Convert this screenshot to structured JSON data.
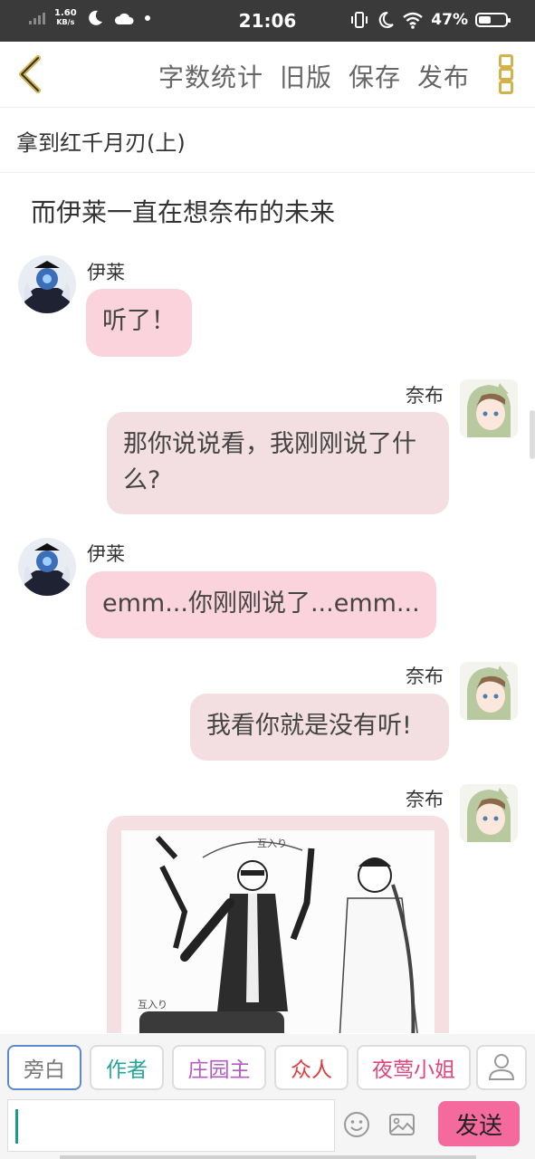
{
  "status_bar": {
    "speed_value": "1.60",
    "speed_unit": "KB/s",
    "time": "21:06",
    "battery": "47%",
    "battery_level": 0.47
  },
  "toolbar": {
    "actions": [
      "字数统计",
      "旧版",
      "保存",
      "发布"
    ]
  },
  "chapter_title": "拿到红千月刃(上)",
  "narration": "而伊莱一直在想奈布的未来",
  "messages": [
    {
      "speaker": "伊莱",
      "text": "听了！"
    },
    {
      "speaker": "奈布",
      "text": "那你说说看，我刚刚说了什么?"
    },
    {
      "speaker": "伊莱",
      "text": "emm...你刚刚说了...emm..."
    },
    {
      "speaker": "奈布",
      "text": "我看你就是没有听!"
    },
    {
      "speaker": "奈布",
      "image_label": "互入り"
    }
  ],
  "roles": [
    {
      "label": "旁白",
      "color": "#777777"
    },
    {
      "label": "作者",
      "color": "#26a69a"
    },
    {
      "label": "庄园主",
      "color": "#b05cc0"
    },
    {
      "label": "众人",
      "color": "#e23a3a"
    },
    {
      "label": "夜莺小姐",
      "color": "#e0467a"
    }
  ],
  "input": {
    "value": ""
  },
  "send_label": "发送",
  "icons": {
    "back": "chevron-left-icon",
    "menu": "more-vertical-icon",
    "person": "person-icon",
    "emoji": "emoji-icon",
    "image": "image-icon"
  }
}
